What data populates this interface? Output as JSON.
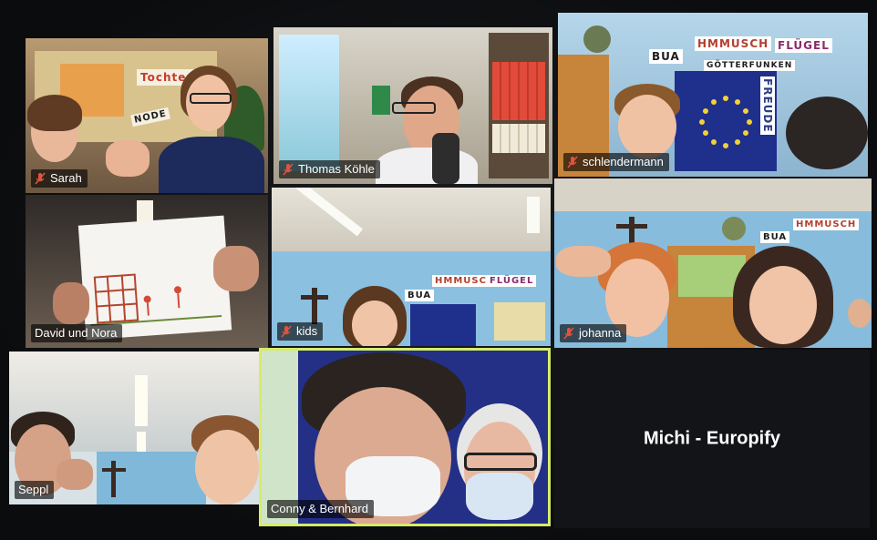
{
  "meeting": {
    "participants": [
      {
        "id": "sarah",
        "name": "Sarah",
        "muted": true
      },
      {
        "id": "thomas",
        "name": "Thomas Köhle",
        "muted": true
      },
      {
        "id": "schlendermann",
        "name": "schlendermann",
        "muted": true
      },
      {
        "id": "david-nora",
        "name": "David und Nora",
        "muted": false
      },
      {
        "id": "kids",
        "name": "kids",
        "muted": true
      },
      {
        "id": "johanna",
        "name": "johanna",
        "muted": true
      },
      {
        "id": "seppl",
        "name": "Seppl",
        "muted": false
      },
      {
        "id": "conny-bernhard",
        "name": "Conny & Bernhard",
        "muted": false,
        "active_speaker": true
      },
      {
        "id": "michi",
        "name": "Michi - Europify",
        "muted": false,
        "video_off": true
      }
    ]
  },
  "scene_text": {
    "sarah_poster_1": "Tochter",
    "sarah_poster_2": "NODE",
    "poster_1": "BUA",
    "poster_2": "HMMUSCH",
    "poster_3": "FLÜGEL",
    "poster_4": "GÖTTERFUNKEN",
    "poster_5": "FREUDE"
  },
  "colors": {
    "active_speaker_border": "#d6ec6a",
    "muted_icon": "#e0533d",
    "label_bg": "rgba(0,0,0,0.62)",
    "eu_flag": "#1f2f8c",
    "star": "#f2d235"
  }
}
